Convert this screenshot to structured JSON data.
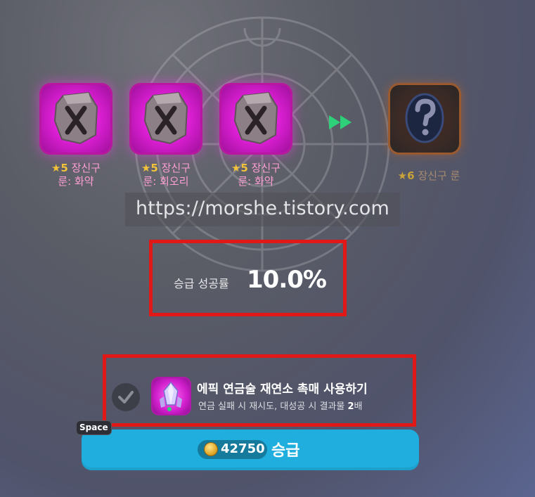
{
  "materials": [
    {
      "star_level": "5",
      "type_label": "장신구",
      "rune_name": "룬: 화약",
      "icon": "rune-x-icon"
    },
    {
      "star_level": "5",
      "type_label": "장신구",
      "rune_name": "룬: 회오리",
      "icon": "rune-x-icon"
    },
    {
      "star_level": "5",
      "type_label": "장신구",
      "rune_name": "룬: 화약",
      "icon": "rune-x-icon"
    }
  ],
  "result": {
    "star_level": "6",
    "label": "장신구 룬",
    "icon": "unknown-rune-question-icon"
  },
  "star_glyph": "★",
  "watermark": "https://morshe.tistory.com",
  "success_rate": {
    "label": "승급 성공률",
    "value": "10.0%"
  },
  "catalyst": {
    "checked": true,
    "title": "에픽 연금술 재연소 촉매 사용하기",
    "desc_prefix": "연금 실패 시 재시도, 대성공 시 결과물 ",
    "desc_multiplier": "2",
    "desc_suffix": "배",
    "icon": "crystal-catalyst-icon"
  },
  "upgrade": {
    "hotkey": "Space",
    "cost": "42750",
    "label": "승급",
    "currency_icon": "gold-coin-icon"
  },
  "colors": {
    "material_frame": "#e020d8",
    "result_frame": "#9a5a30",
    "highlight_box": "#e01818",
    "button": "#1faede",
    "arrow": "#2fd07a"
  }
}
